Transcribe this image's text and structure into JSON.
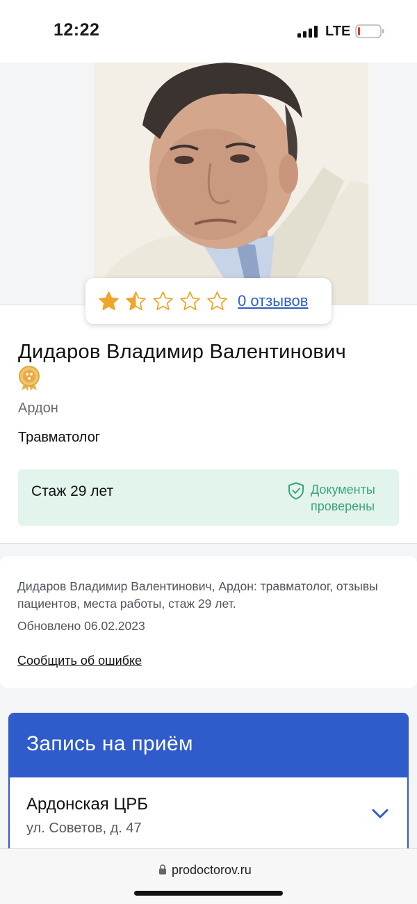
{
  "status_bar": {
    "time": "12:22",
    "network": "LTE"
  },
  "doctor": {
    "photo_icon": "doctor-portrait",
    "rating_stars": 1.5,
    "rating_max": 5,
    "reviews_link": "0 отзывов",
    "name": "Дидаров Владимир Валентинович",
    "badge_icon": "medal-icon",
    "city": "Ардон",
    "specialty": "Травматолог",
    "experience": "Стаж 29 лет",
    "documents_status": "Документы проверены"
  },
  "info": {
    "description": "Дидаров Владимир Валентинович, Ардон: травматолог, отзывы пациентов, места работы, стаж 29 лет.",
    "updated": "Обновлено 06.02.2023",
    "report_error": "Сообщить об ошибке"
  },
  "appointment": {
    "title": "Запись на приём",
    "clinic_name": "Ардонская ЦРБ",
    "clinic_address": "ул. Советов, д. 47"
  },
  "browser": {
    "url": "prodoctorov.ru"
  },
  "colors": {
    "accent_blue": "#2f5bcb",
    "star_gold": "#f0a62a",
    "success_green": "#3aa57a",
    "success_bg": "#e3f4ec"
  }
}
